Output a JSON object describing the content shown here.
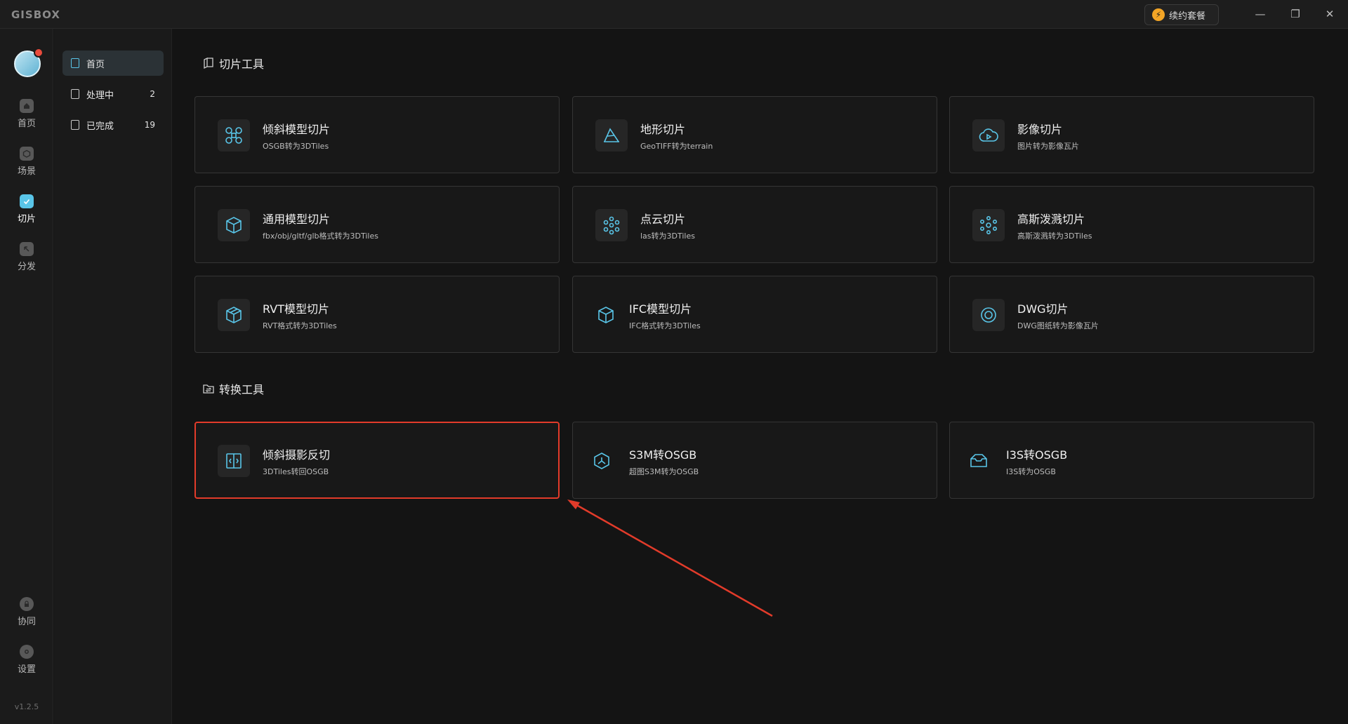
{
  "app": {
    "logo": "GISBOX",
    "version": "v1.2.5"
  },
  "titlebar": {
    "renew_label": "续约套餐",
    "minimize": "—",
    "restore": "❐",
    "close": "✕"
  },
  "rail": {
    "items": [
      {
        "label": "首页",
        "icon": "home-icon"
      },
      {
        "label": "场景",
        "icon": "scene-icon"
      },
      {
        "label": "切片",
        "icon": "slice-icon"
      },
      {
        "label": "分发",
        "icon": "distribute-icon"
      }
    ],
    "bottom": [
      {
        "label": "协同",
        "icon": "lock-icon"
      },
      {
        "label": "设置",
        "icon": "settings-icon"
      }
    ]
  },
  "subnav": {
    "items": [
      {
        "label": "首页",
        "count": ""
      },
      {
        "label": "处理中",
        "count": "2"
      },
      {
        "label": "已完成",
        "count": "19"
      }
    ]
  },
  "sections": {
    "slice": {
      "title": "切片工具",
      "cards": [
        {
          "title": "倾斜模型切片",
          "desc": "OSGB转为3DTiles",
          "icon": "drone-icon"
        },
        {
          "title": "地形切片",
          "desc": "GeoTIFF转为terrain",
          "icon": "terrain-icon"
        },
        {
          "title": "影像切片",
          "desc": "图片转为影像瓦片",
          "icon": "image-cloud-icon"
        },
        {
          "title": "通用模型切片",
          "desc": "fbx/obj/gltf/glb格式转为3DTiles",
          "icon": "cube-icon"
        },
        {
          "title": "点云切片",
          "desc": "las转为3DTiles",
          "icon": "point-cloud-icon"
        },
        {
          "title": "高斯泼溅切片",
          "desc": "高斯泼溅转为3DTiles",
          "icon": "gaussian-icon"
        },
        {
          "title": "RVT模型切片",
          "desc": "RVT格式转为3DTiles",
          "icon": "rvt-icon"
        },
        {
          "title": "IFC模型切片",
          "desc": "IFC格式转为3DTiles",
          "icon": "ifc-icon"
        },
        {
          "title": "DWG切片",
          "desc": "DWG图纸转为影像瓦片",
          "icon": "dwg-icon"
        }
      ]
    },
    "convert": {
      "title": "转换工具",
      "cards": [
        {
          "title": "倾斜摄影反切",
          "desc": "3DTiles转回OSGB",
          "icon": "reverse-icon"
        },
        {
          "title": "S3M转OSGB",
          "desc": "超图S3M转为OSGB",
          "icon": "s3m-icon"
        },
        {
          "title": "I3S转OSGB",
          "desc": "I3S转为OSGB",
          "icon": "i3s-icon"
        }
      ]
    }
  },
  "colors": {
    "accent": "#59c5e8",
    "highlight": "#e23b2a",
    "background": "#141414"
  }
}
